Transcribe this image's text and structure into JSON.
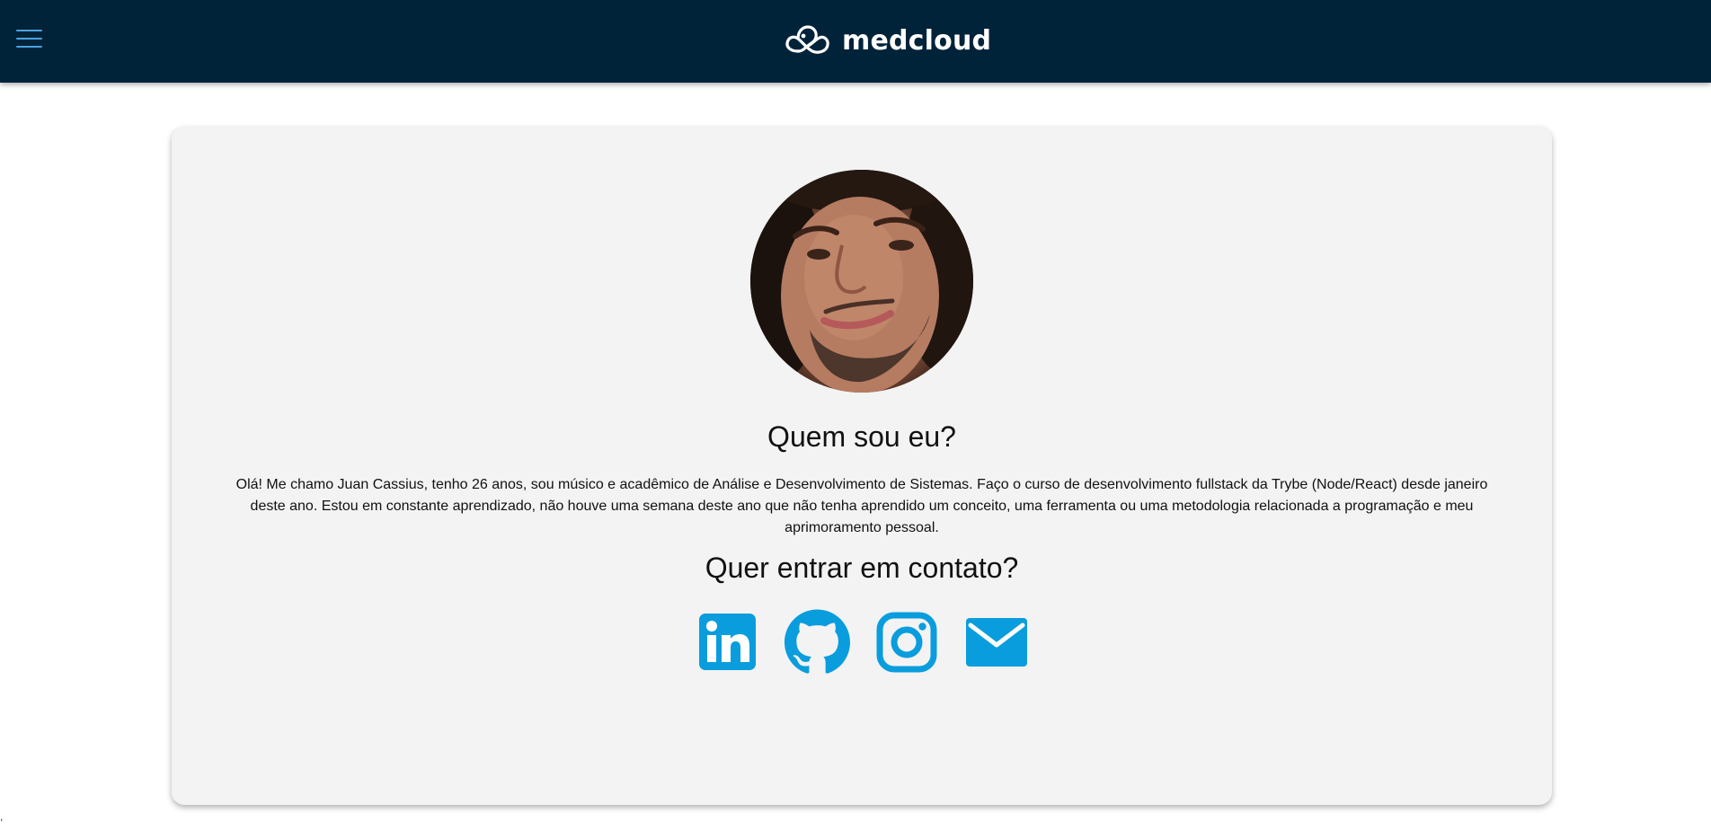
{
  "header": {
    "brand_name": "medcloud",
    "menu_icon": "hamburger-menu-icon",
    "logo_icon": "cloud-infinity-logo-icon",
    "background_color": "#00233a",
    "accent_color": "#4aa3df"
  },
  "profile": {
    "avatar_alt": "Juan Cassius",
    "about_title": "Quem sou eu?",
    "about_text": "Olá! Me chamo Juan Cassius, tenho 26 anos, sou músico e acadêmico de Análise e Desenvolvimento de Sistemas. Faço o curso de desenvolvimento fullstack da Trybe (Node/React) desde janeiro deste ano. Estou em constante aprendizado, não houve uma semana deste ano que não tenha aprendido um conceito, uma ferramenta ou uma metodologia relacionada a programação e meu aprimoramento pessoal.",
    "contact_title": "Quer entrar em contato?"
  },
  "contacts": [
    {
      "name": "LinkedIn",
      "icon": "linkedin-icon"
    },
    {
      "name": "GitHub",
      "icon": "github-icon"
    },
    {
      "name": "Instagram",
      "icon": "instagram-icon"
    },
    {
      "name": "Email",
      "icon": "mail-icon"
    }
  ],
  "contact_icon_color": "#0a9ddd",
  "card_background": "#f3f3f3",
  "footer": {
    "stray_text": ","
  }
}
